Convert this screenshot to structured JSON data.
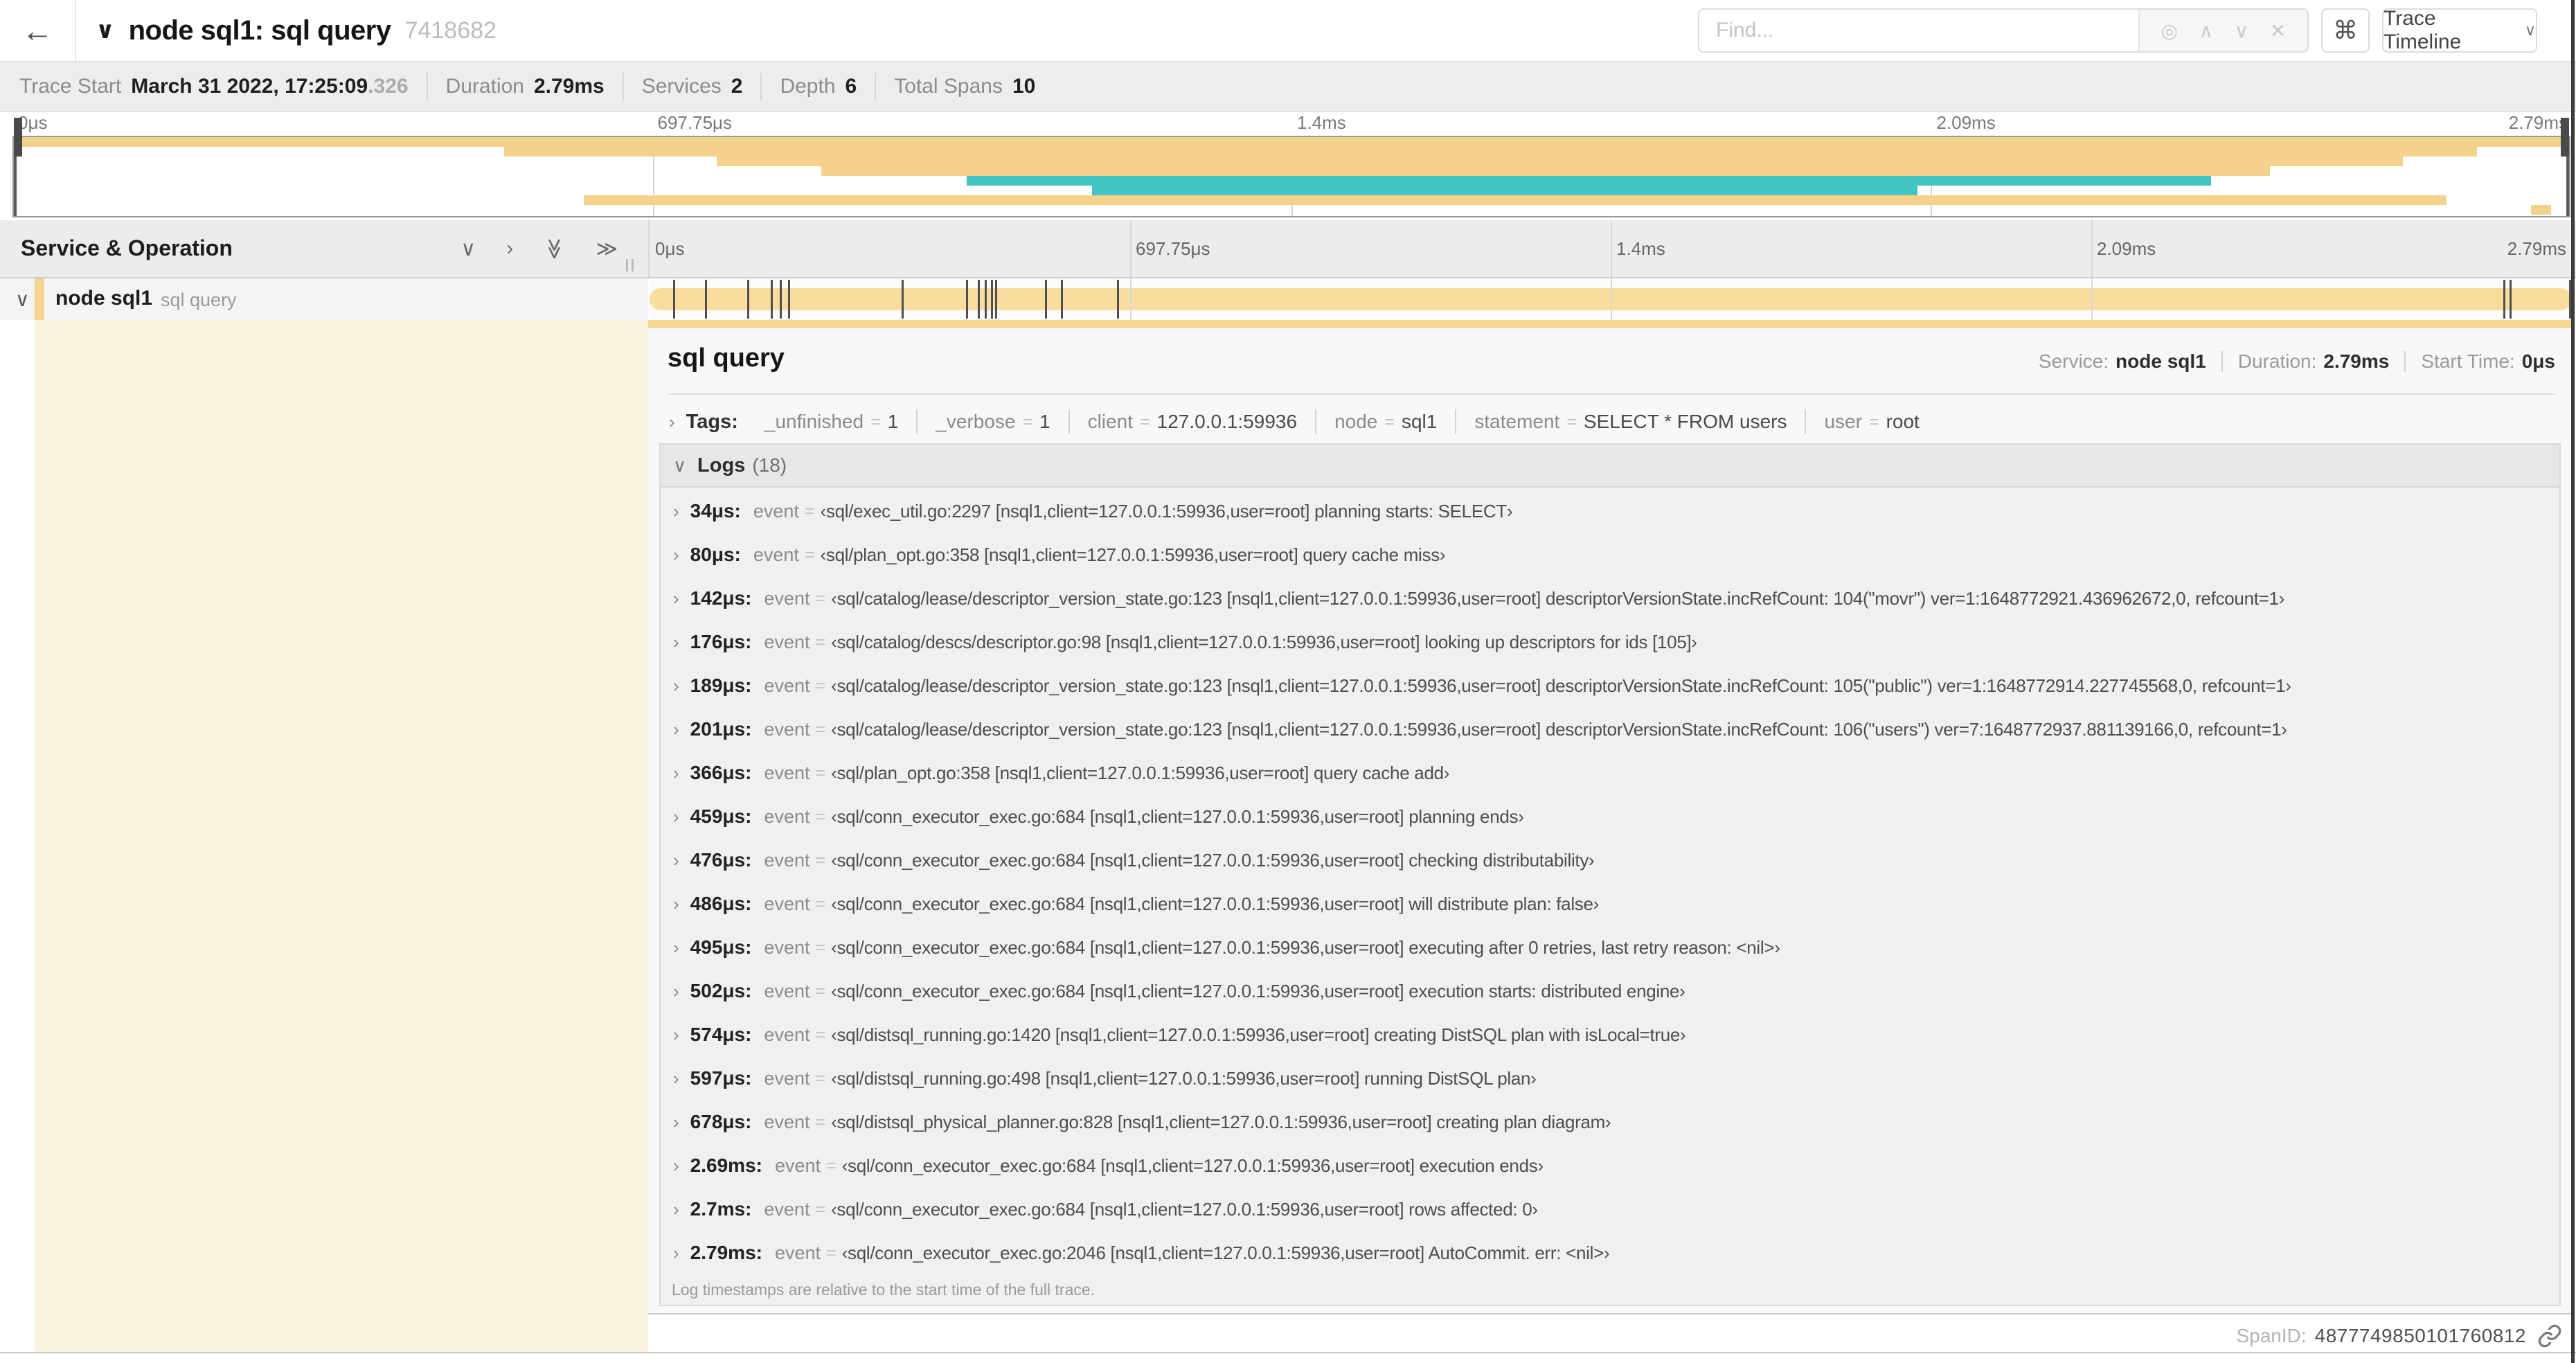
{
  "colors": {
    "span_tan": "#f4d28c",
    "span_tan_light": "#f9dd9f",
    "span_teal": "#41c4c4",
    "accent_strip": "#f6d893",
    "name_accent": "#f5d68f",
    "cream_column": "#faf3de"
  },
  "icons": {
    "back": "←",
    "chevron_down": "∨",
    "chevron_right": "›",
    "double_chevron_right": "≫",
    "locate": "◎",
    "prev": "∧",
    "next": "∨",
    "clear": "✕",
    "command": "⌘",
    "caret_down": "∨",
    "grip": "||"
  },
  "header": {
    "title": "node sql1: sql query",
    "trace_id": "7418682",
    "find_placeholder": "Find...",
    "shortcut_key": "⌘",
    "view_select": "Trace Timeline"
  },
  "meta": {
    "items": [
      {
        "label": "Trace Start",
        "value": "March 31 2022, 17:25:09",
        "suffix": ".326"
      },
      {
        "label": "Duration",
        "value": "2.79ms"
      },
      {
        "label": "Services",
        "value": "2"
      },
      {
        "label": "Depth",
        "value": "6"
      },
      {
        "label": "Total Spans",
        "value": "10"
      }
    ]
  },
  "timeline": {
    "ticks": [
      {
        "label": "0μs",
        "pct": 0
      },
      {
        "label": "697.75μs",
        "pct": 25
      },
      {
        "label": "1.4ms",
        "pct": 50
      },
      {
        "label": "2.09ms",
        "pct": 75
      },
      {
        "label": "2.79ms",
        "pct": 100
      }
    ],
    "minimap_spans": [
      {
        "color": "#f4d28c",
        "start": 0,
        "end": 100
      },
      {
        "color": "#f4d28c",
        "start": 19.2,
        "end": 96.4
      },
      {
        "color": "#f4d28c",
        "start": 27.5,
        "end": 93.5
      },
      {
        "color": "#f4d28c",
        "start": 31.6,
        "end": 88.3
      },
      {
        "color": "#41c4c4",
        "start": 37.3,
        "end": 86.0
      },
      {
        "color": "#41c4c4",
        "start": 42.2,
        "end": 74.5
      },
      {
        "color": "#f4d28c",
        "start": 22.3,
        "end": 95.2
      },
      {
        "color": "#f4d28c",
        "start": 98.5,
        "end": 99.3
      }
    ]
  },
  "grid": {
    "col_header": "Service & Operation"
  },
  "span_row": {
    "service": "node sql1",
    "operation": "sql query",
    "total_us": 2790,
    "tick_times_us": [
      34,
      80,
      142,
      176,
      189,
      201,
      366,
      459,
      476,
      486,
      495,
      502,
      574,
      597,
      678,
      2690,
      2700,
      2788
    ]
  },
  "detail": {
    "title": "sql query",
    "info": {
      "service_label": "Service:",
      "service_value": "node sql1",
      "duration_label": "Duration:",
      "duration_value": "2.79ms",
      "start_label": "Start Time:",
      "start_value": "0μs"
    },
    "tags_label": "Tags:",
    "tags": [
      {
        "key": "_unfinished",
        "value": "1"
      },
      {
        "key": "_verbose",
        "value": "1"
      },
      {
        "key": "client",
        "value": "127.0.0.1:59936"
      },
      {
        "key": "node",
        "value": "sql1"
      },
      {
        "key": "statement",
        "value": "SELECT * FROM users"
      },
      {
        "key": "user",
        "value": "root"
      }
    ],
    "logs_label": "Logs",
    "logs_count": "(18)",
    "event_key": "event",
    "logs": [
      {
        "time": "34μs:",
        "value": "‹sql/exec_util.go:2297 [nsql1,client=127.0.0.1:59936,user=root] planning starts: SELECT›"
      },
      {
        "time": "80μs:",
        "value": "‹sql/plan_opt.go:358 [nsql1,client=127.0.0.1:59936,user=root] query cache miss›"
      },
      {
        "time": "142μs:",
        "value": "‹sql/catalog/lease/descriptor_version_state.go:123 [nsql1,client=127.0.0.1:59936,user=root] descriptorVersionState.incRefCount: 104(\"movr\") ver=1:1648772921.436962672,0, refcount=1›"
      },
      {
        "time": "176μs:",
        "value": "‹sql/catalog/descs/descriptor.go:98 [nsql1,client=127.0.0.1:59936,user=root] looking up descriptors for ids [105]›"
      },
      {
        "time": "189μs:",
        "value": "‹sql/catalog/lease/descriptor_version_state.go:123 [nsql1,client=127.0.0.1:59936,user=root] descriptorVersionState.incRefCount: 105(\"public\") ver=1:1648772914.227745568,0, refcount=1›"
      },
      {
        "time": "201μs:",
        "value": "‹sql/catalog/lease/descriptor_version_state.go:123 [nsql1,client=127.0.0.1:59936,user=root] descriptorVersionState.incRefCount: 106(\"users\") ver=7:1648772937.881139166,0, refcount=1›"
      },
      {
        "time": "366μs:",
        "value": "‹sql/plan_opt.go:358 [nsql1,client=127.0.0.1:59936,user=root] query cache add›"
      },
      {
        "time": "459μs:",
        "value": "‹sql/conn_executor_exec.go:684 [nsql1,client=127.0.0.1:59936,user=root] planning ends›"
      },
      {
        "time": "476μs:",
        "value": "‹sql/conn_executor_exec.go:684 [nsql1,client=127.0.0.1:59936,user=root] checking distributability›"
      },
      {
        "time": "486μs:",
        "value": "‹sql/conn_executor_exec.go:684 [nsql1,client=127.0.0.1:59936,user=root] will distribute plan: false›"
      },
      {
        "time": "495μs:",
        "value": "‹sql/conn_executor_exec.go:684 [nsql1,client=127.0.0.1:59936,user=root] executing after 0 retries, last retry reason: <nil>›"
      },
      {
        "time": "502μs:",
        "value": "‹sql/conn_executor_exec.go:684 [nsql1,client=127.0.0.1:59936,user=root] execution starts: distributed engine›"
      },
      {
        "time": "574μs:",
        "value": "‹sql/distsql_running.go:1420 [nsql1,client=127.0.0.1:59936,user=root] creating DistSQL plan with isLocal=true›"
      },
      {
        "time": "597μs:",
        "value": "‹sql/distsql_running.go:498 [nsql1,client=127.0.0.1:59936,user=root] running DistSQL plan›"
      },
      {
        "time": "678μs:",
        "value": "‹sql/distsql_physical_planner.go:828 [nsql1,client=127.0.0.1:59936,user=root] creating plan diagram›"
      },
      {
        "time": "2.69ms:",
        "value": "‹sql/conn_executor_exec.go:684 [nsql1,client=127.0.0.1:59936,user=root] execution ends›"
      },
      {
        "time": "2.7ms:",
        "value": "‹sql/conn_executor_exec.go:684 [nsql1,client=127.0.0.1:59936,user=root] rows affected: 0›"
      },
      {
        "time": "2.79ms:",
        "value": "‹sql/conn_executor_exec.go:2046 [nsql1,client=127.0.0.1:59936,user=root] AutoCommit. err: <nil>›"
      }
    ],
    "logs_note": "Log timestamps are relative to the start time of the full trace."
  },
  "footer": {
    "spanid_label": "SpanID:",
    "spanid_value": "4877749850101760812"
  },
  "misc": {
    "eq": "="
  }
}
